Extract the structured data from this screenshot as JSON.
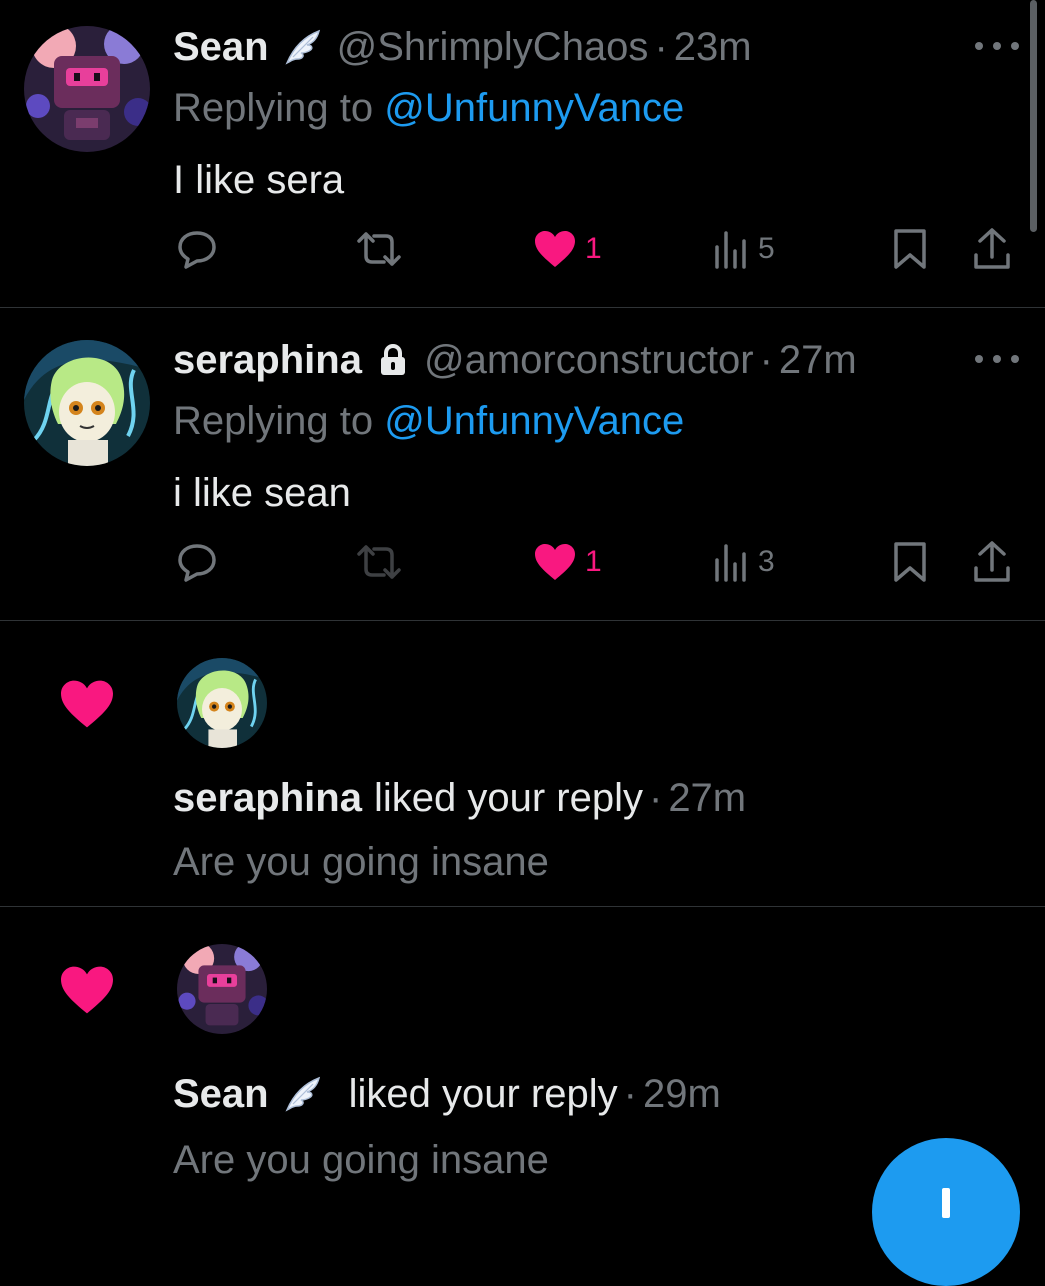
{
  "tweets": [
    {
      "name": "Sean",
      "badge": "wing-icon",
      "handle": "@ShrimplyChaos",
      "separator": "·",
      "time": "23m",
      "replying_prefix": "Replying to ",
      "replying_to": "@UnfunnyVance",
      "text": "I like sera",
      "likes": "1",
      "views": "5"
    },
    {
      "name": "seraphina",
      "badge": "lock-icon",
      "handle": "@amorconstructor",
      "separator": "·",
      "time": "27m",
      "replying_prefix": "Replying to ",
      "replying_to": "@UnfunnyVance",
      "text": "i like sean",
      "likes": "1",
      "views": "3"
    }
  ],
  "notifications": [
    {
      "name": "seraphina",
      "action": "liked your reply",
      "separator": "·",
      "time": "27m",
      "reply_text": "Are you going insane"
    },
    {
      "name": "Sean",
      "badge": "wing-icon",
      "action": "liked your reply",
      "separator": "·",
      "time": "29m",
      "reply_text": "Are you going insane"
    }
  ],
  "colors": {
    "background": "#000000",
    "text": "#e7e9ea",
    "secondary": "#71767b",
    "link": "#1d9bf0",
    "like": "#f91880",
    "divider": "#2f3336",
    "fab": "#1d9bf0"
  }
}
